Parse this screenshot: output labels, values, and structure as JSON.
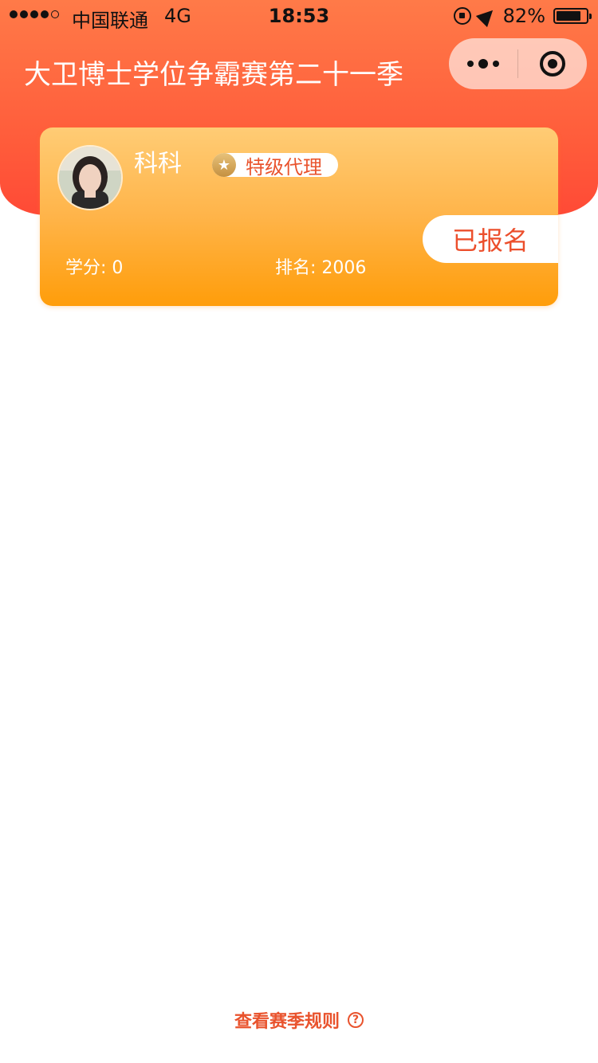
{
  "status_bar": {
    "carrier": "中国联通",
    "network": "4G",
    "time": "18:53",
    "battery": "82%",
    "battery_level": 0.82
  },
  "nav": {
    "title": "大卫博士学位争霸赛第二十一季",
    "more_icon": "more-dots-icon",
    "close_icon": "target-close-icon"
  },
  "profile": {
    "name": "科科",
    "level": "特级代理",
    "level_icon": "star-icon",
    "enroll_label": "已报名",
    "credits_label": "学分:",
    "credits_value": "0",
    "rank_label": "排名:",
    "rank_value": "2006"
  },
  "footer": {
    "rules_label": "查看赛季规则",
    "help_icon": "question-circle-icon"
  },
  "colors": {
    "header": "#ff5a3a",
    "card_top": "#ffcc75",
    "card_bottom": "#ff9d0a",
    "accent_text": "#e9532d"
  }
}
